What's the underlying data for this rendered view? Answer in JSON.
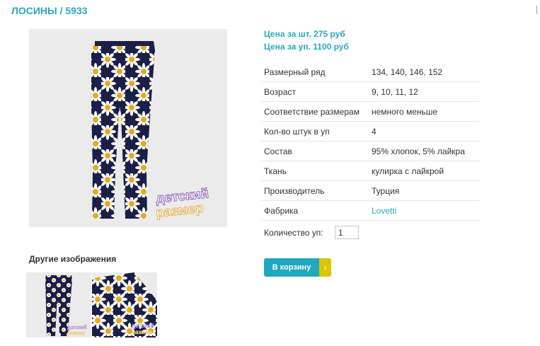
{
  "product": {
    "title": "ЛОСИНЫ / 5933",
    "price_per_item": "Цена за шт. 275 руб",
    "price_per_pack": "Цена за уп. 1100 руб"
  },
  "gallery": {
    "other_images_label": "Другие изображения",
    "watermark_line1": "детский",
    "watermark_line2": "размер"
  },
  "properties": [
    {
      "label": "Размерный ряд",
      "value": "134, 140, 146, 152"
    },
    {
      "label": "Возраст",
      "value": "9, 10, 11, 12"
    },
    {
      "label": "Соответствие размерам",
      "value": "немного меньше"
    },
    {
      "label": "Кол-во штук в уп",
      "value": "4"
    },
    {
      "label": "Состав",
      "value": "95% хлопок, 5% лайкра"
    },
    {
      "label": "Ткань",
      "value": "кулирка с лайкрой"
    },
    {
      "label": "Производитель",
      "value": "Турция"
    },
    {
      "label": "Фабрика",
      "value": "Lovetti"
    }
  ],
  "order": {
    "quantity_label": "Количество уп:",
    "quantity_value": "1",
    "add_to_cart_label": "В корзину",
    "add_to_cart_arrow": "›"
  },
  "colors": {
    "accent": "#28a9bd",
    "button": "#1fa8bf",
    "button_arrow": "#d7c600",
    "fabric": "#1b1e45"
  }
}
